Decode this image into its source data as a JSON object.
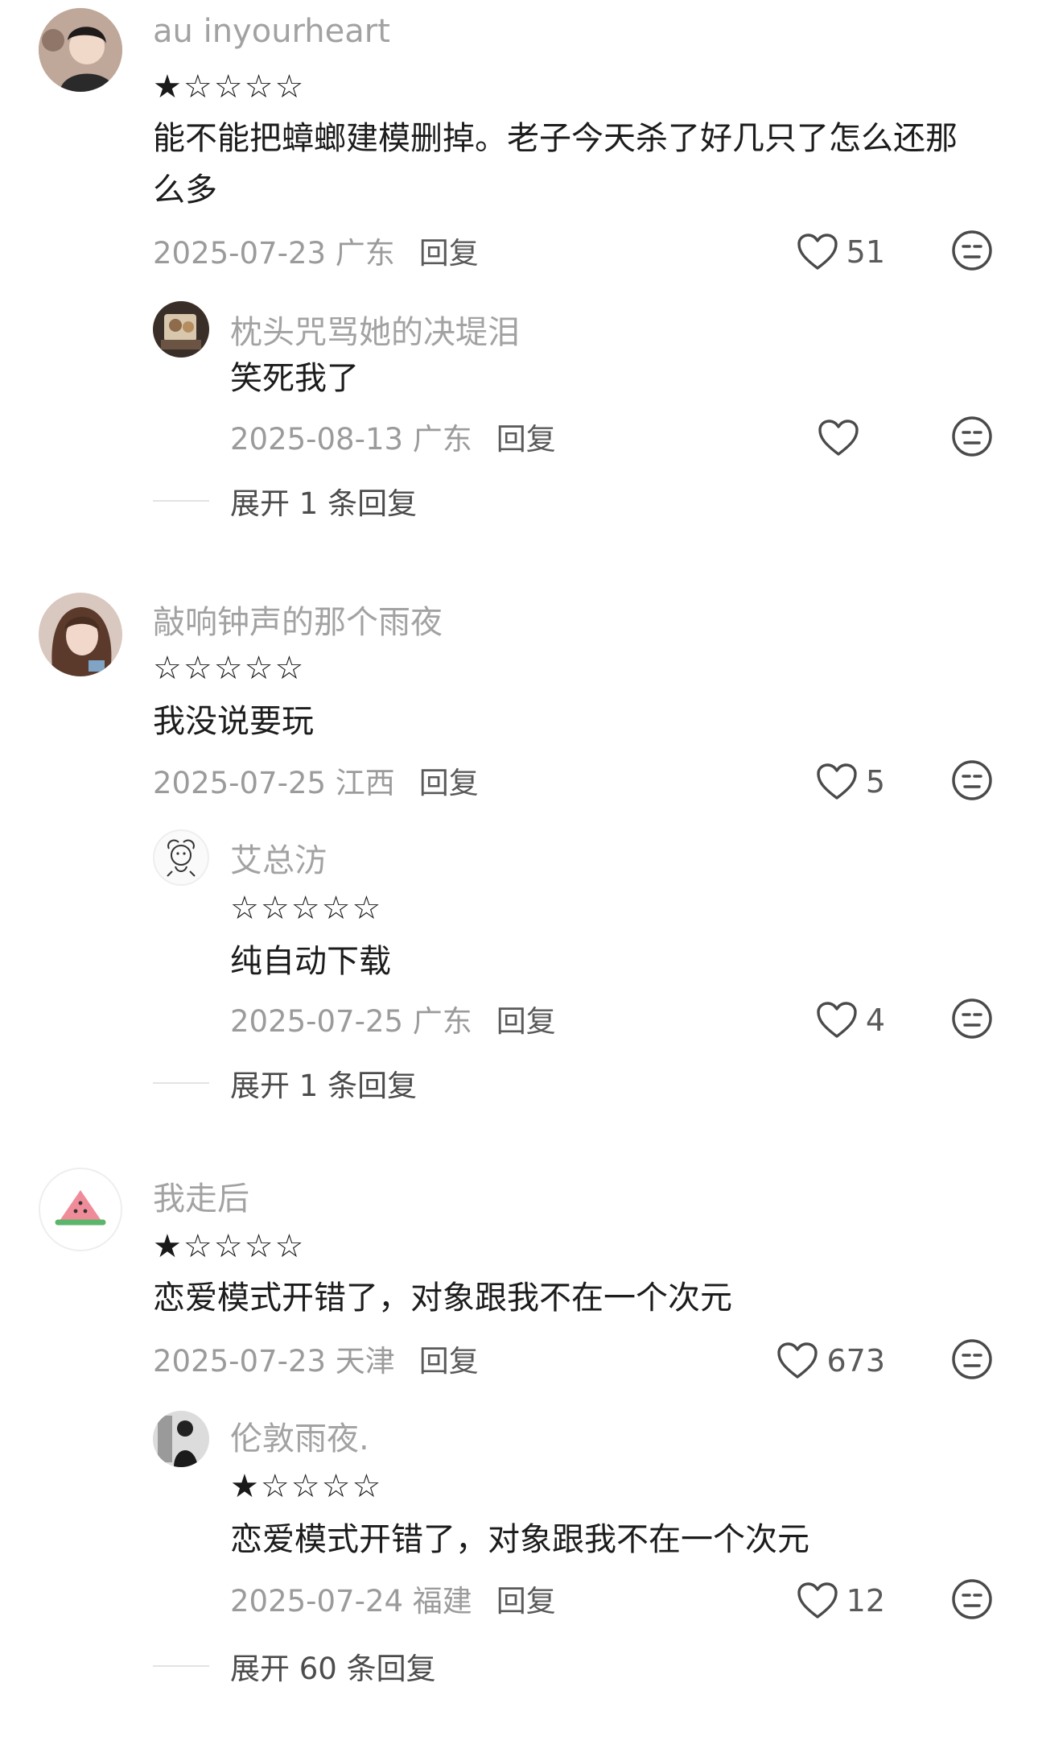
{
  "comments": [
    {
      "username": "au inyourheart",
      "stars": "★☆☆☆☆",
      "text_lines": [
        "能不能把蟑螂建模删掉。老子今天杀了好几只了怎么还那",
        "么多"
      ],
      "date": "2025-07-23 广东",
      "reply_label": "回复",
      "likes": "51",
      "avatar_icon": "user-avatar-girl",
      "sub": {
        "username": "枕头咒骂她的决堤泪",
        "text_lines": [
          "笑死我了"
        ],
        "date": "2025-08-13 广东",
        "reply_label": "回复",
        "likes": "",
        "avatar_icon": "user-avatar-photo"
      },
      "expand_label": "展开 1 条回复"
    },
    {
      "username": "敲响钟声的那个雨夜",
      "stars": "☆☆☆☆☆",
      "text_lines": [
        "我没说要玩"
      ],
      "date": "2025-07-25 江西",
      "reply_label": "回复",
      "likes": "5",
      "avatar_icon": "user-avatar-girl",
      "sub": {
        "username": "艾总汸",
        "stars": "☆☆☆☆☆",
        "text_lines": [
          "纯自动下载"
        ],
        "date": "2025-07-25 广东",
        "reply_label": "回复",
        "likes": "4",
        "avatar_icon": "user-avatar-sketch"
      },
      "expand_label": "展开 1 条回复"
    },
    {
      "username": "我走后",
      "stars": "★☆☆☆☆",
      "text_lines": [
        "恋爱模式开错了，对象跟我不在一个次元"
      ],
      "date": "2025-07-23 天津",
      "reply_label": "回复",
      "likes": "673",
      "avatar_icon": "watermelon-avatar",
      "sub": {
        "username": "伦敦雨夜.",
        "stars": "★☆☆☆☆",
        "text_lines": [
          "恋爱模式开错了，对象跟我不在一个次元"
        ],
        "date": "2025-07-24 福建",
        "reply_label": "回复",
        "likes": "12",
        "avatar_icon": "user-avatar-bw-photo"
      },
      "expand_label": "展开 60 条回复"
    }
  ],
  "colors": {
    "username": "#a2a2a2",
    "meta": "#9b9b9b",
    "text": "#1c1c1c",
    "reply": "#5a5a5a"
  }
}
